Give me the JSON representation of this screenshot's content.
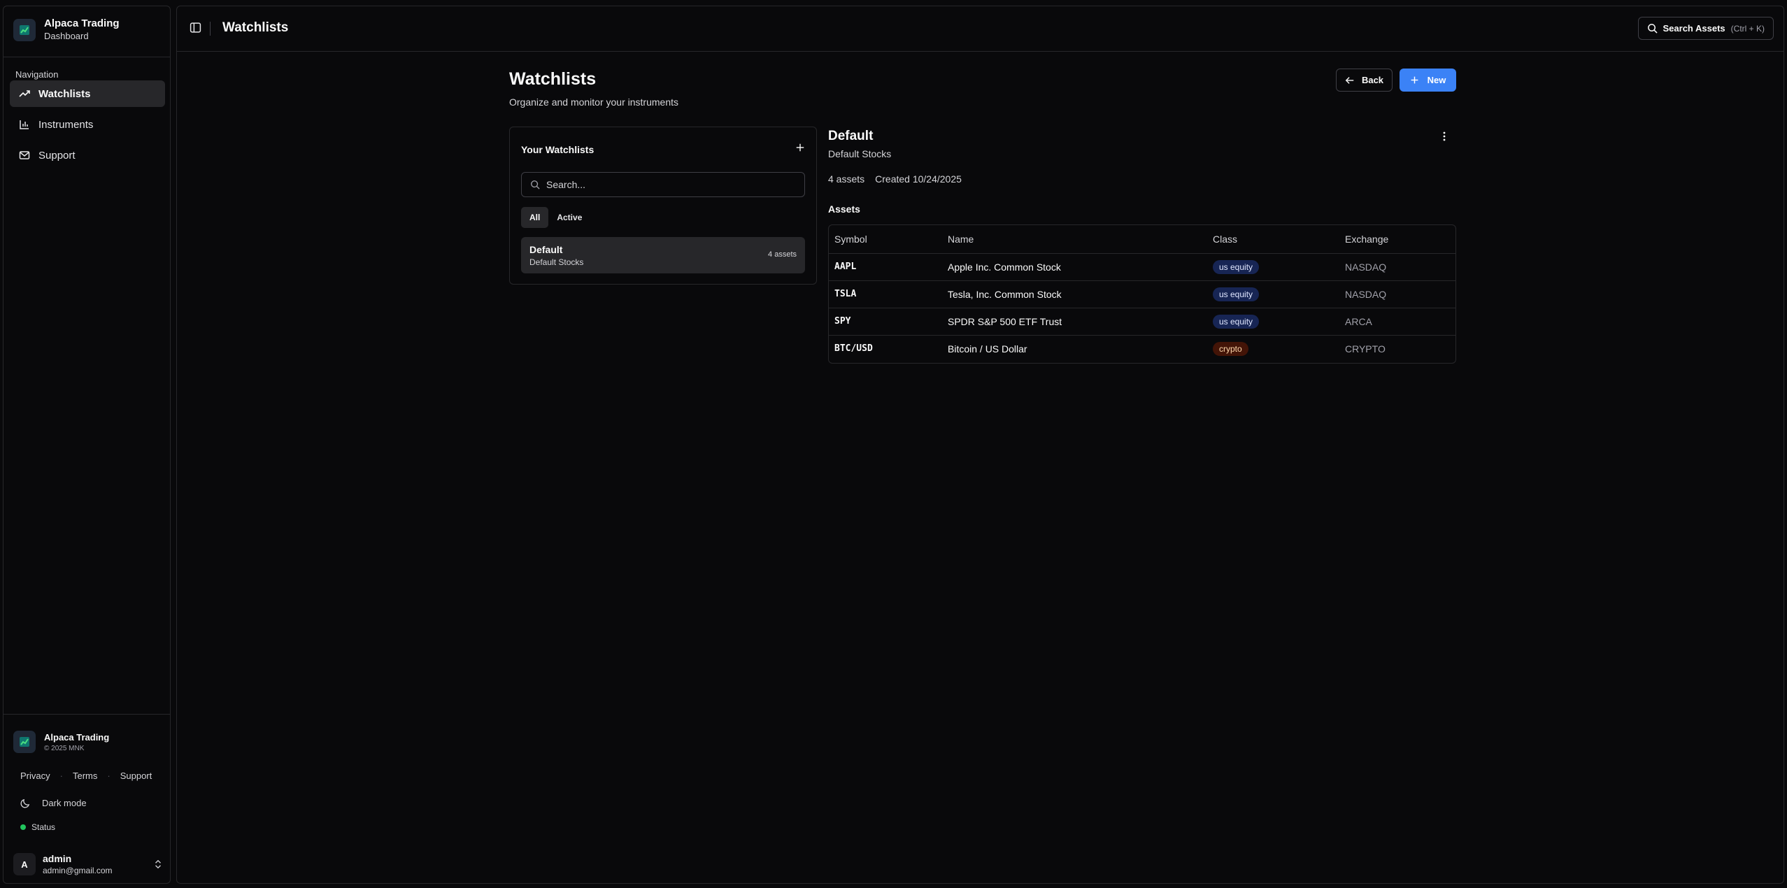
{
  "sidebar": {
    "brand": {
      "title": "Alpaca Trading",
      "subtitle": "Dashboard"
    },
    "nav_label": "Navigation",
    "items": [
      {
        "label": "Watchlists",
        "icon": "trending-up-icon",
        "active": true
      },
      {
        "label": "Instruments",
        "icon": "bar-chart-icon",
        "active": false
      },
      {
        "label": "Support",
        "icon": "mail-icon",
        "active": false
      }
    ],
    "footer": {
      "brand_title": "Alpaca Trading",
      "copyright": "© 2025 MNK",
      "links": [
        "Privacy",
        "Terms",
        "Support"
      ],
      "dark_mode": "Dark mode",
      "status": "Status"
    },
    "user": {
      "initial": "A",
      "name": "admin",
      "email": "admin@gmail.com"
    }
  },
  "topbar": {
    "title": "Watchlists",
    "search_label": "Search Assets",
    "search_shortcut": "(Ctrl + K)"
  },
  "page": {
    "title": "Watchlists",
    "subtitle": "Organize and monitor your instruments",
    "back_label": "Back",
    "new_label": "New"
  },
  "watchlists_panel": {
    "title": "Your Watchlists",
    "search_placeholder": "Search...",
    "tabs": [
      "All",
      "Active"
    ],
    "items": [
      {
        "name": "Default",
        "description": "Default Stocks",
        "count": "4 assets"
      }
    ]
  },
  "detail": {
    "name": "Default",
    "description": "Default Stocks",
    "asset_count": "4 assets",
    "created": "Created 10/24/2025",
    "assets_label": "Assets",
    "columns": [
      "Symbol",
      "Name",
      "Class",
      "Exchange"
    ],
    "rows": [
      {
        "symbol": "AAPL",
        "name": "Apple Inc. Common Stock",
        "class": "us equity",
        "exchange": "NASDAQ"
      },
      {
        "symbol": "TSLA",
        "name": "Tesla, Inc. Common Stock",
        "class": "us equity",
        "exchange": "NASDAQ"
      },
      {
        "symbol": "SPY",
        "name": "SPDR S&P 500 ETF Trust",
        "class": "us equity",
        "exchange": "ARCA"
      },
      {
        "symbol": "BTC/USD",
        "name": "Bitcoin / US Dollar",
        "class": "crypto",
        "exchange": "CRYPTO"
      }
    ]
  },
  "colors": {
    "background": "#09090b",
    "border": "#27272a",
    "accent": "#3b82f6",
    "status_ok": "#22c55e",
    "equity_badge": "#172554",
    "crypto_badge": "#431407"
  }
}
